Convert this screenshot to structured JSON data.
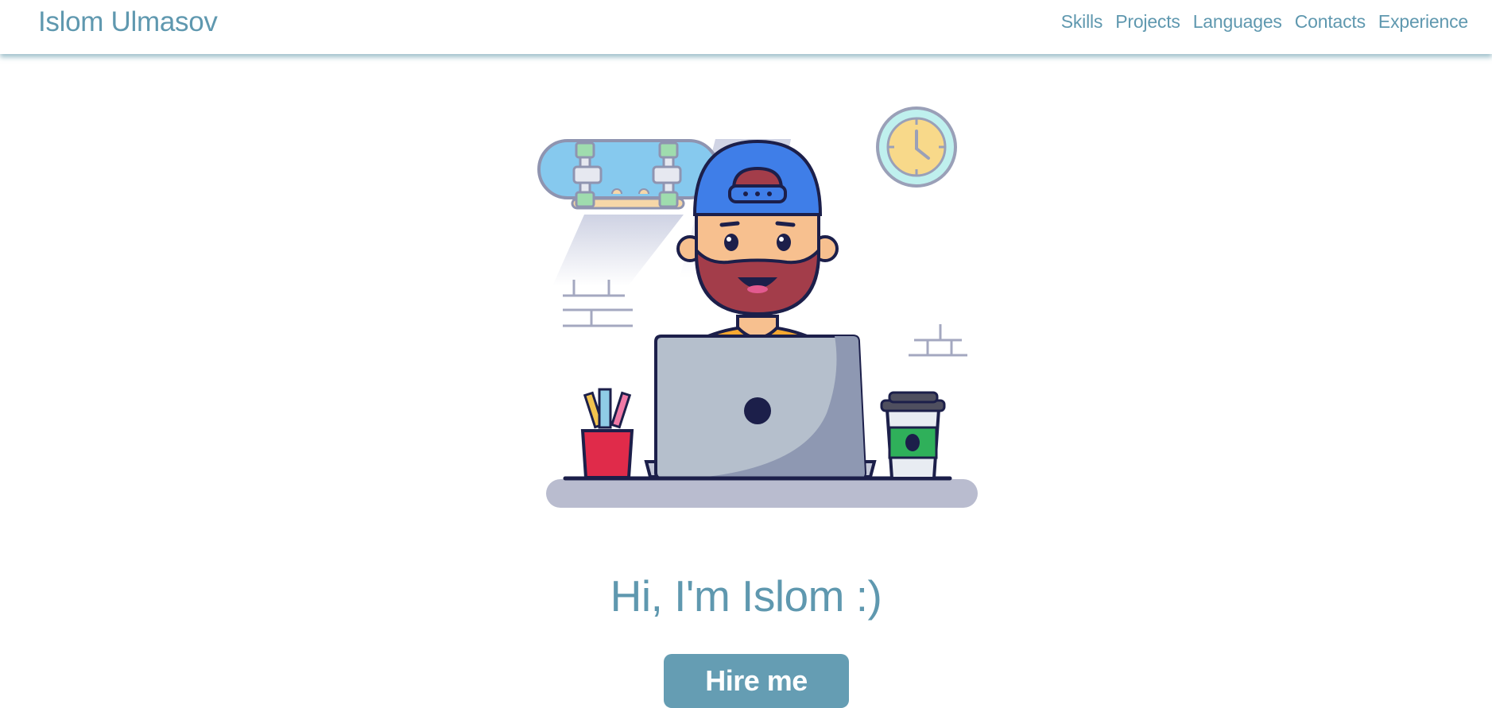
{
  "navbar": {
    "brand": "Islom Ulmasov",
    "links": [
      "Skills",
      "Projects",
      "Languages",
      "Contacts",
      "Experience"
    ]
  },
  "hero": {
    "title": "Hi, I'm Islom :)",
    "cta_label": "Hire me",
    "illustration": "developer-at-laptop-illustration"
  },
  "colors": {
    "accent": "#5f98af",
    "button": "#659db3",
    "background": "#ffffff"
  }
}
